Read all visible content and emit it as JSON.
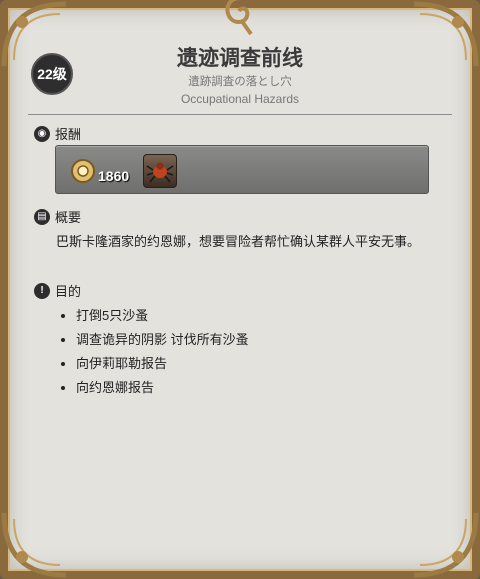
{
  "quest": {
    "level": "22级",
    "title": "遗迹调查前线",
    "subtitle_jp": "遺跡調査の落とし穴",
    "subtitle_en": "Occupational Hazards"
  },
  "reward": {
    "heading": "报酬",
    "gil_amount": "1860",
    "gil_icon": "gil-coin-icon",
    "item_icon": "spider-item-icon"
  },
  "summary": {
    "heading": "概要",
    "text": "巴斯卡隆酒家的约恩娜，想要冒险者帮忙确认某群人平安无事。"
  },
  "objectives": {
    "heading": "目的",
    "items": [
      "打倒5只沙蚤",
      "调查诡异的阴影 讨伐所有沙蚤",
      "向伊莉耶勒报告",
      "向约恩娜报告"
    ]
  },
  "colors": {
    "panel": "#e3e2dd",
    "frame": "#8a6a3c",
    "badge": "#2e2e2e"
  }
}
